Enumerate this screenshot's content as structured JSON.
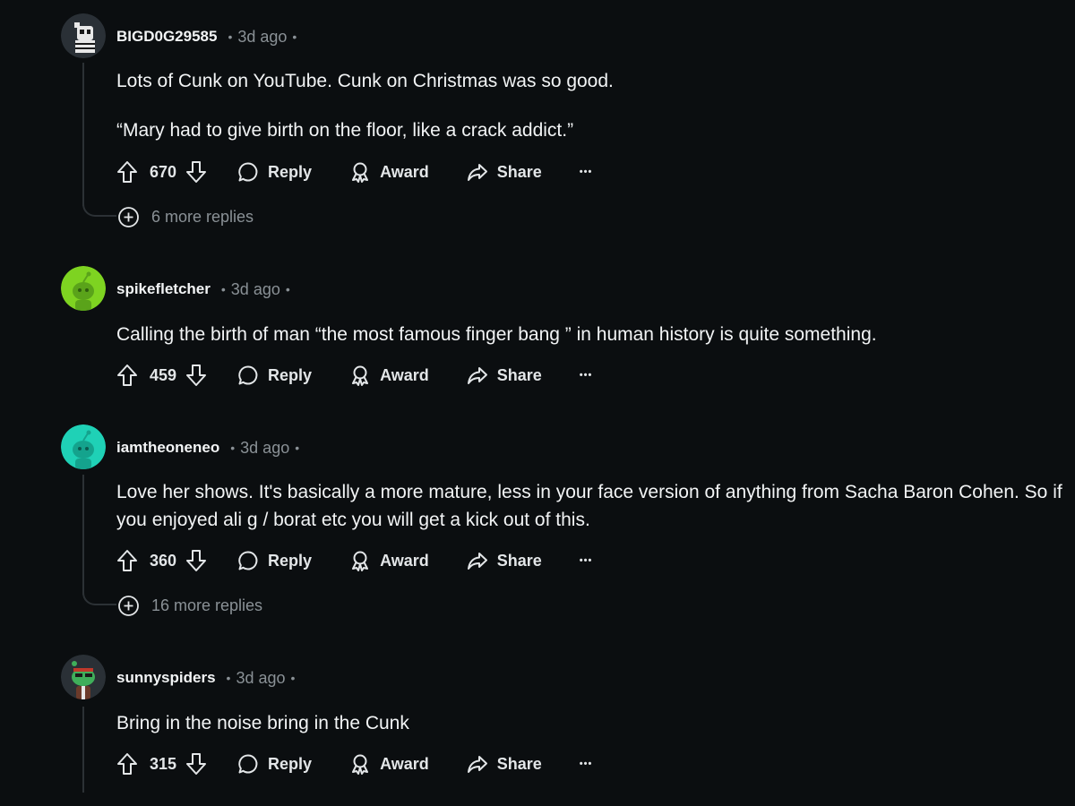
{
  "comments": [
    {
      "username": "BIGD0G29585",
      "time": "3d ago",
      "body": [
        "Lots of Cunk on YouTube. Cunk on Christmas was so good.",
        "“Mary had to give birth on the floor, like a crack addict.”"
      ],
      "score": "670",
      "more_replies": "6 more replies",
      "avatar_icon": "robot-snoo-avatar"
    },
    {
      "username": "spikefletcher",
      "time": "3d ago",
      "body": [
        "Calling the birth of man “the most famous finger bang ” in human history is quite something."
      ],
      "score": "459",
      "avatar_icon": "green-snoo-avatar"
    },
    {
      "username": "iamtheoneneo",
      "time": "3d ago",
      "body": [
        "Love her shows. It's basically a more mature, less in your face version of anything from Sacha Baron Cohen. So if you enjoyed ali g / borat etc you will get a kick out of this."
      ],
      "score": "360",
      "more_replies": "16 more replies",
      "avatar_icon": "teal-snoo-avatar"
    },
    {
      "username": "sunnyspiders",
      "time": "3d ago",
      "body": [
        "Bring in the noise bring in the Cunk"
      ],
      "score": "315",
      "avatar_icon": "dark-snoo-avatar"
    }
  ],
  "actions": {
    "reply": "Reply",
    "award": "Award",
    "share": "Share",
    "overflow": "•••"
  },
  "separator": "•",
  "colors": {
    "background": "#0b0e10",
    "text": "#f2f4f5",
    "muted": "#8a9196",
    "thread_line": "#2c3135"
  }
}
